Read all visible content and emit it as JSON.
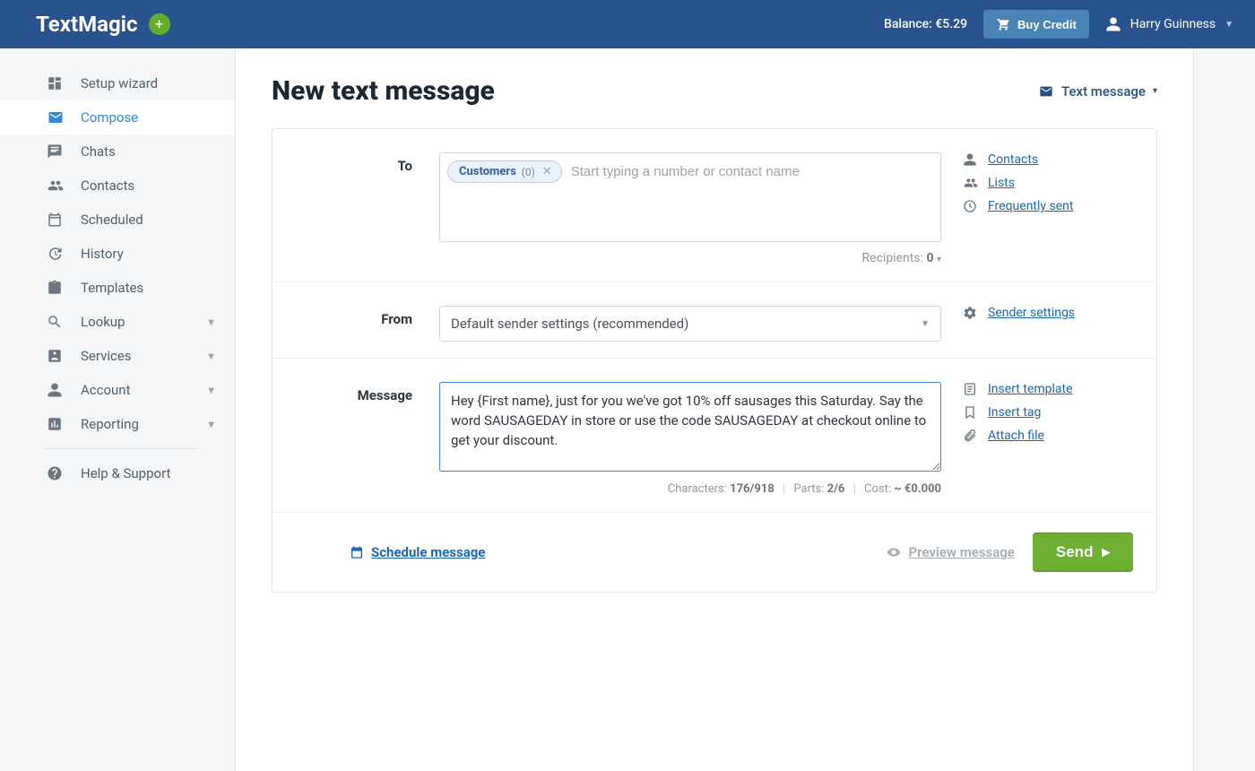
{
  "brand": "TextMagic",
  "balance_label": "Balance: €5.29",
  "buy_credit_label": "Buy Credit",
  "user_name": "Harry Guinness",
  "sidebar": {
    "items": [
      {
        "label": "Setup wizard"
      },
      {
        "label": "Compose"
      },
      {
        "label": "Chats"
      },
      {
        "label": "Contacts"
      },
      {
        "label": "Scheduled"
      },
      {
        "label": "History"
      },
      {
        "label": "Templates"
      },
      {
        "label": "Lookup"
      },
      {
        "label": "Services"
      },
      {
        "label": "Account"
      },
      {
        "label": "Reporting"
      }
    ],
    "help_label": "Help & Support"
  },
  "page": {
    "title": "New text message",
    "type_dropdown": "Text message"
  },
  "to": {
    "label": "To",
    "chip_name": "Customers",
    "chip_count": "(0)",
    "placeholder": "Start typing a number or contact name",
    "recipients_label": "Recipients:",
    "recipients_value": "0",
    "links": [
      "Contacts",
      "Lists",
      "Frequently sent"
    ]
  },
  "from": {
    "label": "From",
    "value": "Default sender settings (recommended)",
    "link": "Sender settings"
  },
  "message": {
    "label": "Message",
    "text": "Hey {First name}, just for you we've got 10% off sausages this Saturday. Say the word SAUSAGEDAY in store or use the code SAUSAGEDAY at checkout online to get your discount. ",
    "links": [
      "Insert template",
      "Insert tag",
      "Attach file"
    ],
    "chars_label": "Characters:",
    "chars_value": "176/918",
    "parts_label": "Parts:",
    "parts_value": "2/6",
    "cost_label": "Cost:",
    "cost_value": "~ €0.000"
  },
  "footer": {
    "schedule_label": "Schedule message",
    "preview_label": "Preview message",
    "send_label": "Send"
  }
}
